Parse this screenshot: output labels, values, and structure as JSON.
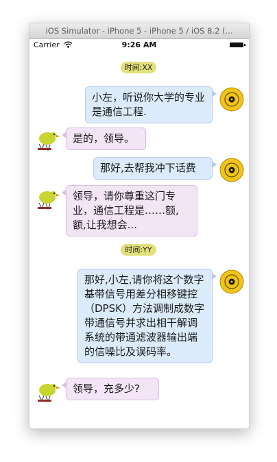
{
  "window": {
    "title": "iOS Simulator - iPhone 5 - iPhone 5 / iOS 8.2 (..."
  },
  "status_bar": {
    "carrier": "Carrier",
    "time": "9:26 AM"
  },
  "timestamps": [
    "时间:XX",
    "时间:YY"
  ],
  "messages": [
    {
      "from": "me",
      "text": "小左，听说你大学的专业是通信工程."
    },
    {
      "from": "other",
      "text": "是的，领导。"
    },
    {
      "from": "me",
      "text": "那好,去帮我冲下话费"
    },
    {
      "from": "other",
      "text": "领导，请你尊重这门专业，通信工程是……额,额,让我想会..."
    },
    {
      "from": "me",
      "text": "那好,小左,请你将这个数字基带信号用差分相移键控（DPSK）方法调制成数字带通信号并求出相干解调系统的带通滤波器输出端的信噪比及误码率。"
    },
    {
      "from": "other",
      "text": "领导，充多少?"
    }
  ],
  "colors": {
    "timestamp_bg": "#e2e07a",
    "my_bubble": "#dcebfb",
    "other_bubble": "#f3e4f6",
    "avatar_disc": "#f0c419"
  },
  "icons": {
    "me_avatar": "yellow-disc-avatar-icon",
    "other_avatar": "bird-avatar-icon"
  }
}
